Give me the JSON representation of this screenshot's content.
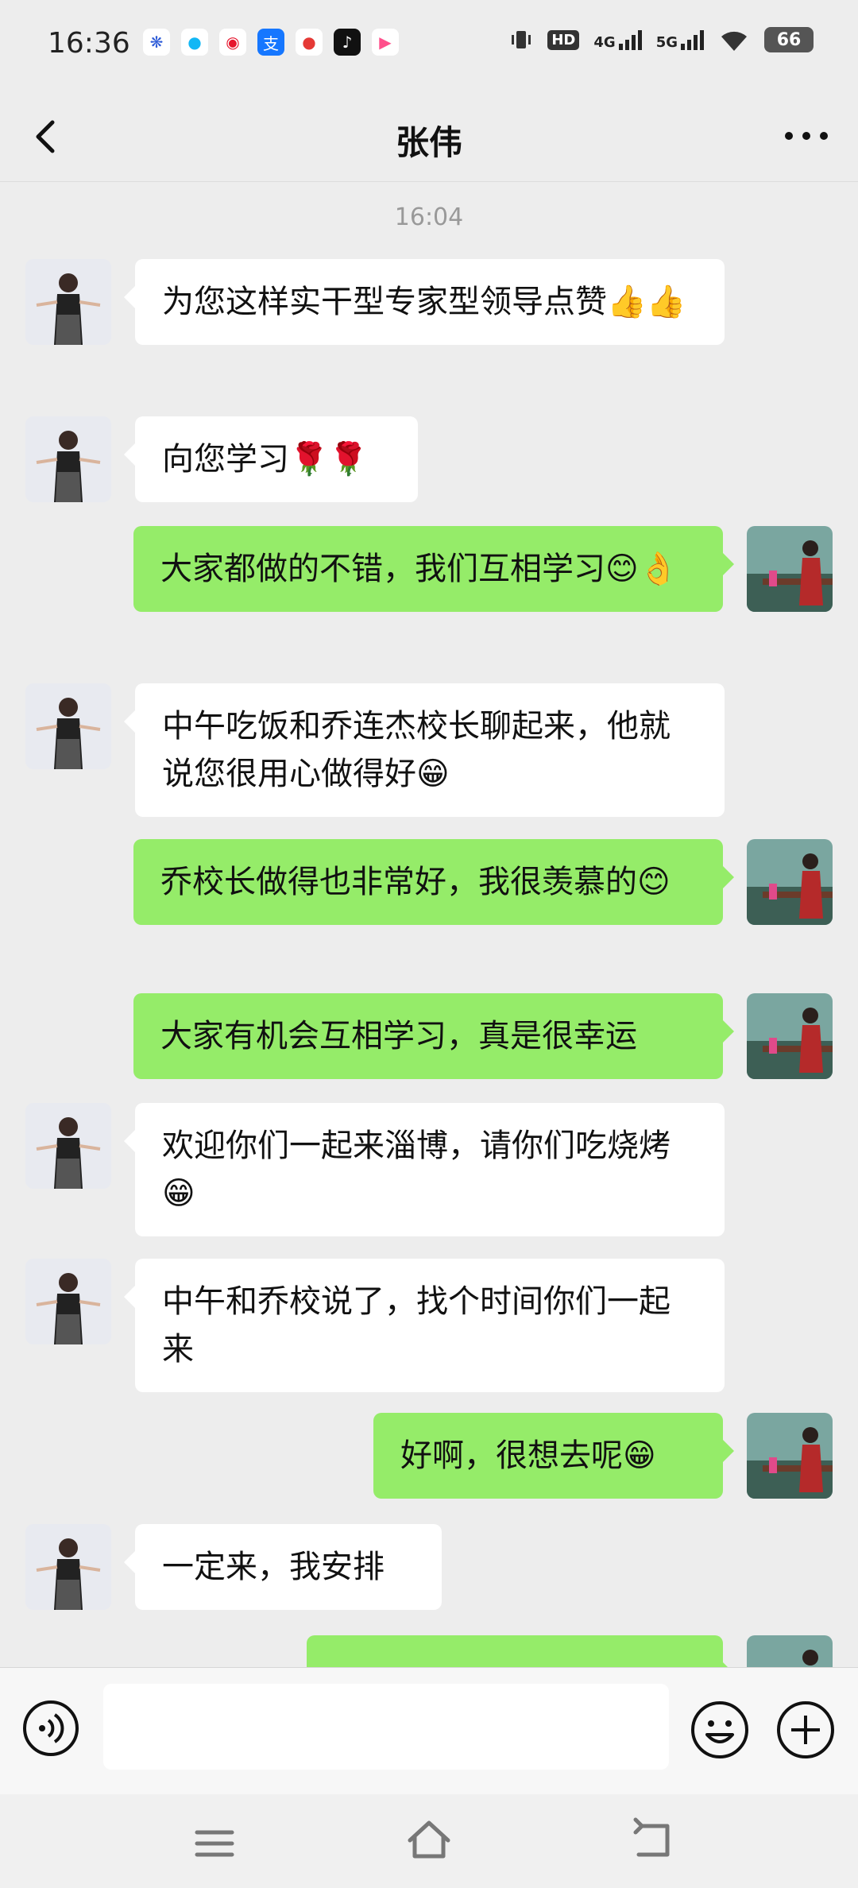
{
  "status": {
    "time": "16:36",
    "network1": "4G",
    "network2": "5G",
    "battery": "66",
    "hd": "HD"
  },
  "header": {
    "title": "张伟"
  },
  "chat": {
    "timestamp": "16:04",
    "messages": [
      {
        "side": "in",
        "text": "为您这样实干型专家型领导点赞👍👍"
      },
      {
        "side": "in",
        "text": "向您学习🌹🌹"
      },
      {
        "side": "out",
        "text": "大家都做的不错，我们互相学习😊👌"
      },
      {
        "side": "in",
        "text": "中午吃饭和乔连杰校长聊起来，他就说您很用心做得好😁"
      },
      {
        "side": "out",
        "text": "乔校长做得也非常好，我很羡慕的😊"
      },
      {
        "side": "out",
        "text": "大家有机会互相学习，真是很幸运"
      },
      {
        "side": "in",
        "text": "欢迎你们一起来淄博，请你们吃烧烤😁"
      },
      {
        "side": "in",
        "text": "中午和乔校说了，找个时间你们一起来"
      },
      {
        "side": "out",
        "text": "好啊，很想去呢😁"
      },
      {
        "side": "in",
        "text": "一定来，我安排"
      }
    ]
  },
  "input": {
    "value": "",
    "placeholder": ""
  },
  "icons": {
    "back": "chevron-left-icon",
    "more": "more-dots-icon",
    "voice": "voice-icon",
    "emoji": "emoji-icon",
    "plus": "plus-icon"
  },
  "colors": {
    "background": "#ededed",
    "incoming_bubble": "#ffffff",
    "outgoing_bubble": "#95ec69"
  }
}
